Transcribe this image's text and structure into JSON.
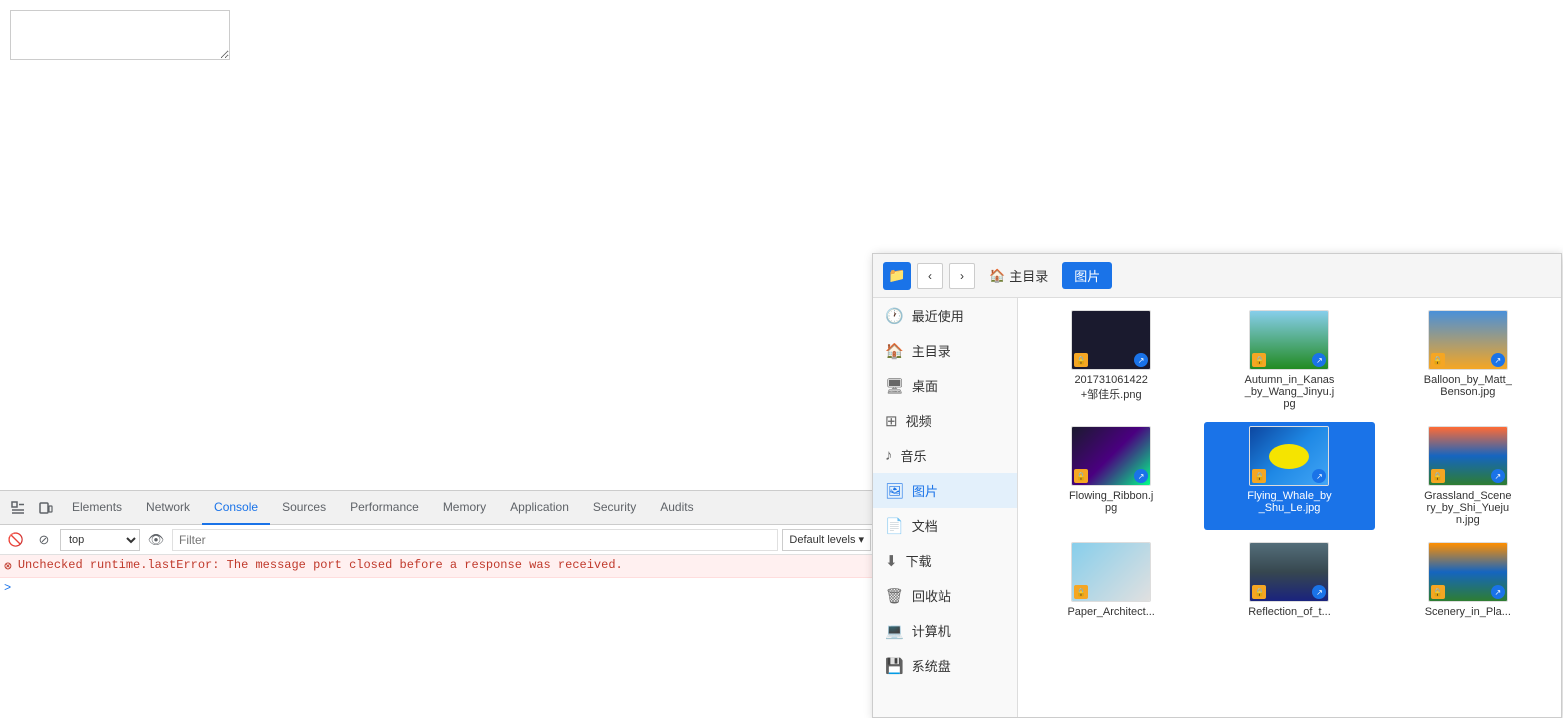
{
  "browser": {
    "textarea_placeholder": ""
  },
  "devtools": {
    "tabs": [
      {
        "id": "elements",
        "label": "Elements",
        "active": false
      },
      {
        "id": "network",
        "label": "Network",
        "active": false
      },
      {
        "id": "console",
        "label": "Console",
        "active": true
      },
      {
        "id": "sources",
        "label": "Sources",
        "active": false
      },
      {
        "id": "performance",
        "label": "Performance",
        "active": false
      },
      {
        "id": "memory",
        "label": "Memory",
        "active": false
      },
      {
        "id": "application",
        "label": "Application",
        "active": false
      },
      {
        "id": "security",
        "label": "Security",
        "active": false
      },
      {
        "id": "audits",
        "label": "Audits",
        "active": false
      }
    ],
    "toolbar": {
      "context": "top",
      "filter_placeholder": "Filter",
      "levels": "Default levels"
    },
    "console_error": "Unchecked runtime.lastError: The message port closed before a response was received.",
    "console_prompt": ">"
  },
  "filepicker": {
    "title": "图片",
    "home_label": "主目录",
    "current_path_label": "图片",
    "sidebar_items": [
      {
        "id": "recent",
        "label": "最近使用",
        "icon": "🕐",
        "active": false
      },
      {
        "id": "home",
        "label": "主目录",
        "icon": "🏠",
        "active": false
      },
      {
        "id": "desktop",
        "label": "桌面",
        "icon": "🖥",
        "active": false
      },
      {
        "id": "video",
        "label": "视频",
        "icon": "⊞",
        "active": false
      },
      {
        "id": "music",
        "label": "音乐",
        "icon": "♪",
        "active": false
      },
      {
        "id": "pictures",
        "label": "图片",
        "icon": "🖼",
        "active": true
      },
      {
        "id": "documents",
        "label": "文档",
        "icon": "📄",
        "active": false
      },
      {
        "id": "downloads",
        "label": "下载",
        "icon": "⬇",
        "active": false
      },
      {
        "id": "trash",
        "label": "回收站",
        "icon": "🗑",
        "active": false
      },
      {
        "id": "computer",
        "label": "计算机",
        "icon": "💻",
        "active": false
      },
      {
        "id": "disk",
        "label": "系统盘",
        "icon": "💾",
        "active": false
      }
    ],
    "files": [
      {
        "name": "201731061422+邹佳乐.png",
        "thumb": "dark",
        "has_lock": true,
        "has_share": true,
        "selected": false
      },
      {
        "name": "Autumn_in_Kanas_by_Wang_Jinyu.jpg",
        "thumb": "mountain",
        "has_lock": true,
        "has_share": true,
        "selected": false
      },
      {
        "name": "Balloon_by_Matt_Benson.jpg",
        "thumb": "balloon",
        "has_lock": true,
        "has_share": true,
        "selected": false
      },
      {
        "name": "Flowing_Ribbon.jpg",
        "thumb": "flowing",
        "has_lock": true,
        "has_share": true,
        "selected": false
      },
      {
        "name": "Flying_Whale_by_Shu_Le.jpg",
        "thumb": "whale",
        "has_lock": true,
        "has_share": true,
        "selected": true
      },
      {
        "name": "Grassland_Scenery_by_Shi_Yuejun.jpg",
        "thumb": "grassland",
        "has_lock": true,
        "has_share": true,
        "selected": false
      },
      {
        "name": "Paper_Architect...",
        "thumb": "paper",
        "has_lock": true,
        "has_share": false,
        "selected": false
      },
      {
        "name": "Reflection_of_t...",
        "thumb": "reflection",
        "has_lock": true,
        "has_share": true,
        "selected": false
      },
      {
        "name": "Scenery_in_Pla...",
        "thumb": "scenery",
        "has_lock": true,
        "has_share": true,
        "selected": false
      }
    ]
  }
}
